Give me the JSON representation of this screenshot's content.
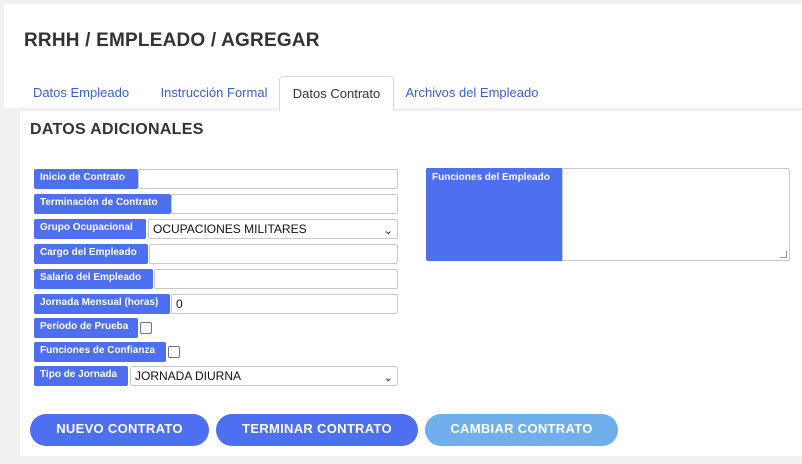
{
  "page": {
    "title": "RRHH / EMPLEADO / AGREGAR"
  },
  "tabs": [
    {
      "label": "Datos Empleado",
      "active": false
    },
    {
      "label": "Instrucción Formal",
      "active": false
    },
    {
      "label": "Datos Contrato",
      "active": true
    },
    {
      "label": "Archivos del Empleado",
      "active": false
    }
  ],
  "section": {
    "title": "DATOS ADICIONALES"
  },
  "form": {
    "inicio_contrato": {
      "label": "Inicio de Contrato",
      "value": ""
    },
    "terminacion_contrato": {
      "label": "Terminación de Contrato",
      "value": ""
    },
    "grupo_ocupacional": {
      "label": "Grupo Ocupacional",
      "value": "OCUPACIONES MILITARES"
    },
    "cargo_empleado": {
      "label": "Cargo del Empleado",
      "value": ""
    },
    "salario_empleado": {
      "label": "Salario del Empleado",
      "value": ""
    },
    "jornada_mensual": {
      "label": "Jornada Mensual (horas)",
      "value": "0"
    },
    "periodo_prueba": {
      "label": "Período de Prueba",
      "checked": false
    },
    "funciones_confianza": {
      "label": "Funciones de Confianza",
      "checked": false
    },
    "tipo_jornada": {
      "label": "Tipo de Jornada",
      "value": "JORNADA DIURNA"
    },
    "funciones_empleado": {
      "label": "Funciones del Empleado",
      "value": ""
    }
  },
  "buttons": {
    "nuevo": "NUEVO CONTRATO",
    "terminar": "TERMINAR CONTRATO",
    "cambiar": "CAMBIAR CONTRATO"
  },
  "colors": {
    "accent": "#4d6ff0",
    "disabled_button": "#6fb0ec",
    "tab_link": "#3a5fcd"
  }
}
